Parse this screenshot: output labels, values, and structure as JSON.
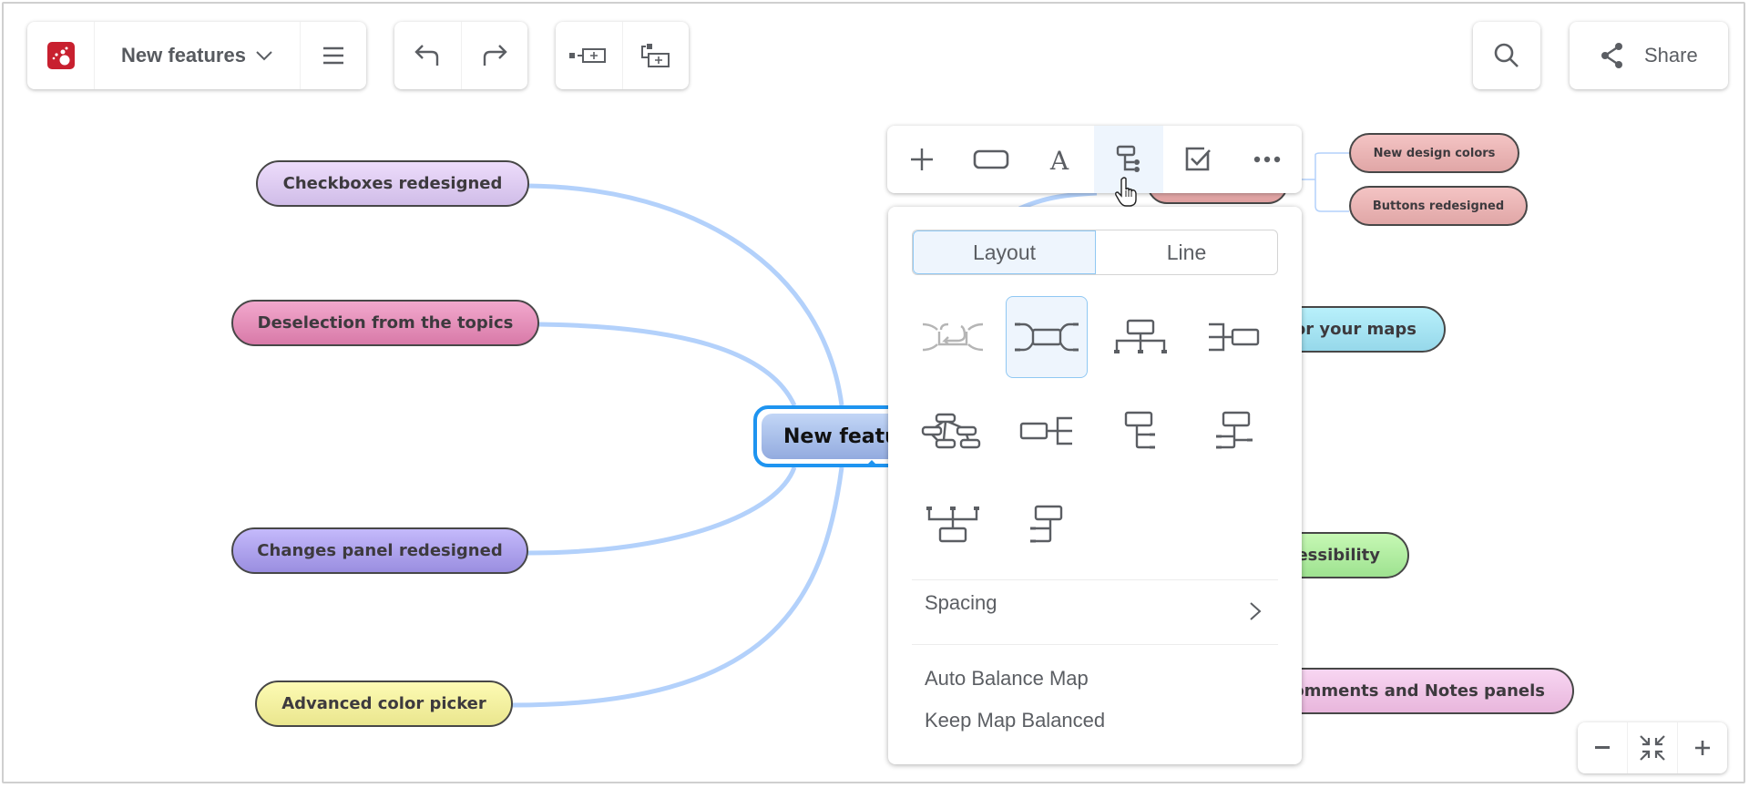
{
  "header": {
    "app_logo": "mindmeister-logo-icon",
    "map_title": "New features",
    "title_dropdown_icon": "chevron-down-icon",
    "menu_icon": "hamburger-menu-icon",
    "undo_icon": "undo-icon",
    "redo_icon": "redo-icon",
    "add_sibling_icon": "add-sibling-topic-icon",
    "add_child_icon": "add-child-topic-icon",
    "search_icon": "search-icon",
    "share_label": "Share",
    "share_icon": "share-icon"
  },
  "map": {
    "central_topic": "New features",
    "left_topics": [
      {
        "label": "Checkboxes redesigned",
        "color": "#dcc8ee"
      },
      {
        "label": "Deselection from the topics",
        "color": "#e488b4"
      },
      {
        "label": "Changes panel redesigned",
        "color": "#ab9fee"
      },
      {
        "label": "Advanced color picker",
        "color": "#f4f0a0"
      }
    ],
    "right_topics": [
      {
        "label": "or your maps",
        "color": "#a6e4f2"
      },
      {
        "label": "essibility",
        "color": "#b2ee9e"
      },
      {
        "label": "omments and Notes panels",
        "color": "#f0c6e6"
      }
    ],
    "right_subtopics": [
      {
        "label": "New design colors",
        "color": "#eab2b2"
      },
      {
        "label": "Buttons redesigned",
        "color": "#eab2b2"
      }
    ],
    "connector_color": "#b3d1fb",
    "selection_color": "#1e94f0"
  },
  "node_toolbar": {
    "buttons": [
      {
        "name": "add-topic",
        "icon": "plus-icon"
      },
      {
        "name": "shape",
        "icon": "rectangle-icon"
      },
      {
        "name": "text-style",
        "icon": "font-icon"
      },
      {
        "name": "layout",
        "icon": "layout-tree-icon",
        "active": true
      },
      {
        "name": "task",
        "icon": "checkbox-icon"
      },
      {
        "name": "more",
        "icon": "more-dots-icon"
      }
    ]
  },
  "layout_popup": {
    "tabs": [
      {
        "label": "Layout",
        "active": true
      },
      {
        "label": "Line",
        "active": false
      }
    ],
    "layouts": [
      {
        "name": "auto-layout",
        "active": false,
        "disabled": true
      },
      {
        "name": "mind-map",
        "active": true
      },
      {
        "name": "org-chart-down",
        "active": false
      },
      {
        "name": "left-tree",
        "active": false
      },
      {
        "name": "free-map",
        "active": false
      },
      {
        "name": "right-tree",
        "active": false
      },
      {
        "name": "list-right",
        "active": false
      },
      {
        "name": "list-both",
        "active": false
      },
      {
        "name": "org-chart-up",
        "active": false
      },
      {
        "name": "list-left",
        "active": false
      }
    ],
    "spacing_label": "Spacing",
    "auto_balance_label": "Auto Balance Map",
    "keep_balanced_label": "Keep Map Balanced"
  },
  "zoom_controls": {
    "zoom_out_icon": "minus-icon",
    "fit_icon": "fit-to-screen-icon",
    "zoom_in_icon": "plus-icon"
  }
}
